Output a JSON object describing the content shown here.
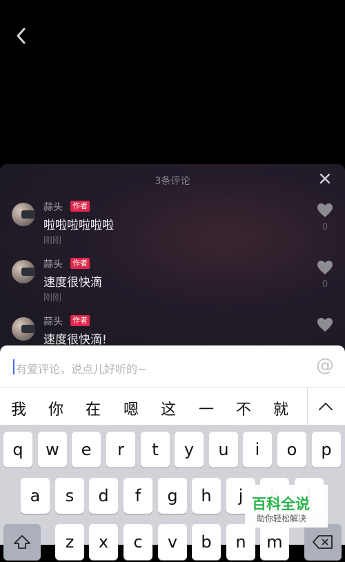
{
  "panel": {
    "title": "3条评论"
  },
  "comments": [
    {
      "username": "蒜头",
      "badge": "作者",
      "text": "啦啦啦啦啦啦",
      "time": "刚刚",
      "likes": "0"
    },
    {
      "username": "蒜头",
      "badge": "作者",
      "text": "速度很快滴",
      "time": "刚刚",
      "likes": "0"
    },
    {
      "username": "蒜头",
      "badge": "作者",
      "text": "速度很快滴!",
      "time": "",
      "likes": ""
    }
  ],
  "input": {
    "placeholder": "有爱评论，说点儿好听的~",
    "at_label": "@"
  },
  "suggestions": [
    "我",
    "你",
    "在",
    "嗯",
    "这",
    "一",
    "不",
    "就"
  ],
  "keyboard": {
    "row1": [
      "q",
      "w",
      "e",
      "r",
      "t",
      "y",
      "u",
      "i",
      "o",
      "p"
    ],
    "row2": [
      "a",
      "s",
      "d",
      "f",
      "g",
      "h",
      "j",
      "k",
      "l"
    ],
    "row3": [
      "z",
      "x",
      "c",
      "v",
      "b",
      "n",
      "m"
    ]
  },
  "watermark": {
    "title": "百科全说",
    "subtitle": "助你轻松解决"
  },
  "colors": {
    "badge": "#e0264b",
    "caret": "#3e6ee8",
    "watermark": "#2ab44a"
  }
}
